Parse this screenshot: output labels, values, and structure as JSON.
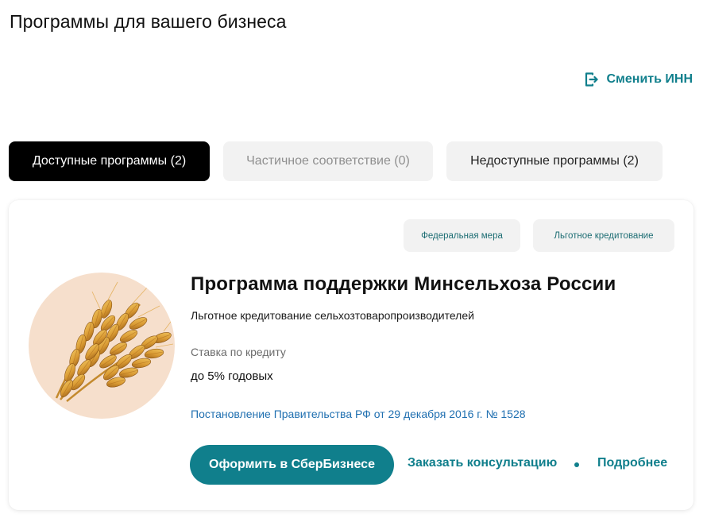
{
  "page": {
    "title": "Программы для вашего бизнеса"
  },
  "header": {
    "change_inn_label": "Сменить ИНН",
    "change_inn_icon": "logout-icon"
  },
  "tabs": [
    {
      "label": "Доступные программы (2)",
      "active": true
    },
    {
      "label": "Частичное соответствие (0)",
      "active": false
    },
    {
      "label": "Недоступные программы (2)",
      "active": false
    }
  ],
  "program": {
    "badges": [
      "Федеральная мера",
      "Льготное кредитование"
    ],
    "image_icon": "wheat-icon",
    "title": "Программа поддержки Минсельхоза России",
    "subtitle": "Льготное кредитование сельхозтоваропроизводителей",
    "rate_label": "Ставка по кредиту",
    "rate_value": "до 5% годовых",
    "decree_link": "Постановление Правительства РФ от 29 декабря 2016 г. № 1528",
    "primary_button": "Оформить в СберБизнесе",
    "consult_link": "Заказать консультацию",
    "more_link": "Подробнее"
  },
  "colors": {
    "accent": "#107f8c",
    "tab_active_bg": "#000000",
    "tab_inactive_bg": "#f2f2f2",
    "link_blue": "#1f6fb0",
    "image_bg": "#f6dfcc"
  }
}
